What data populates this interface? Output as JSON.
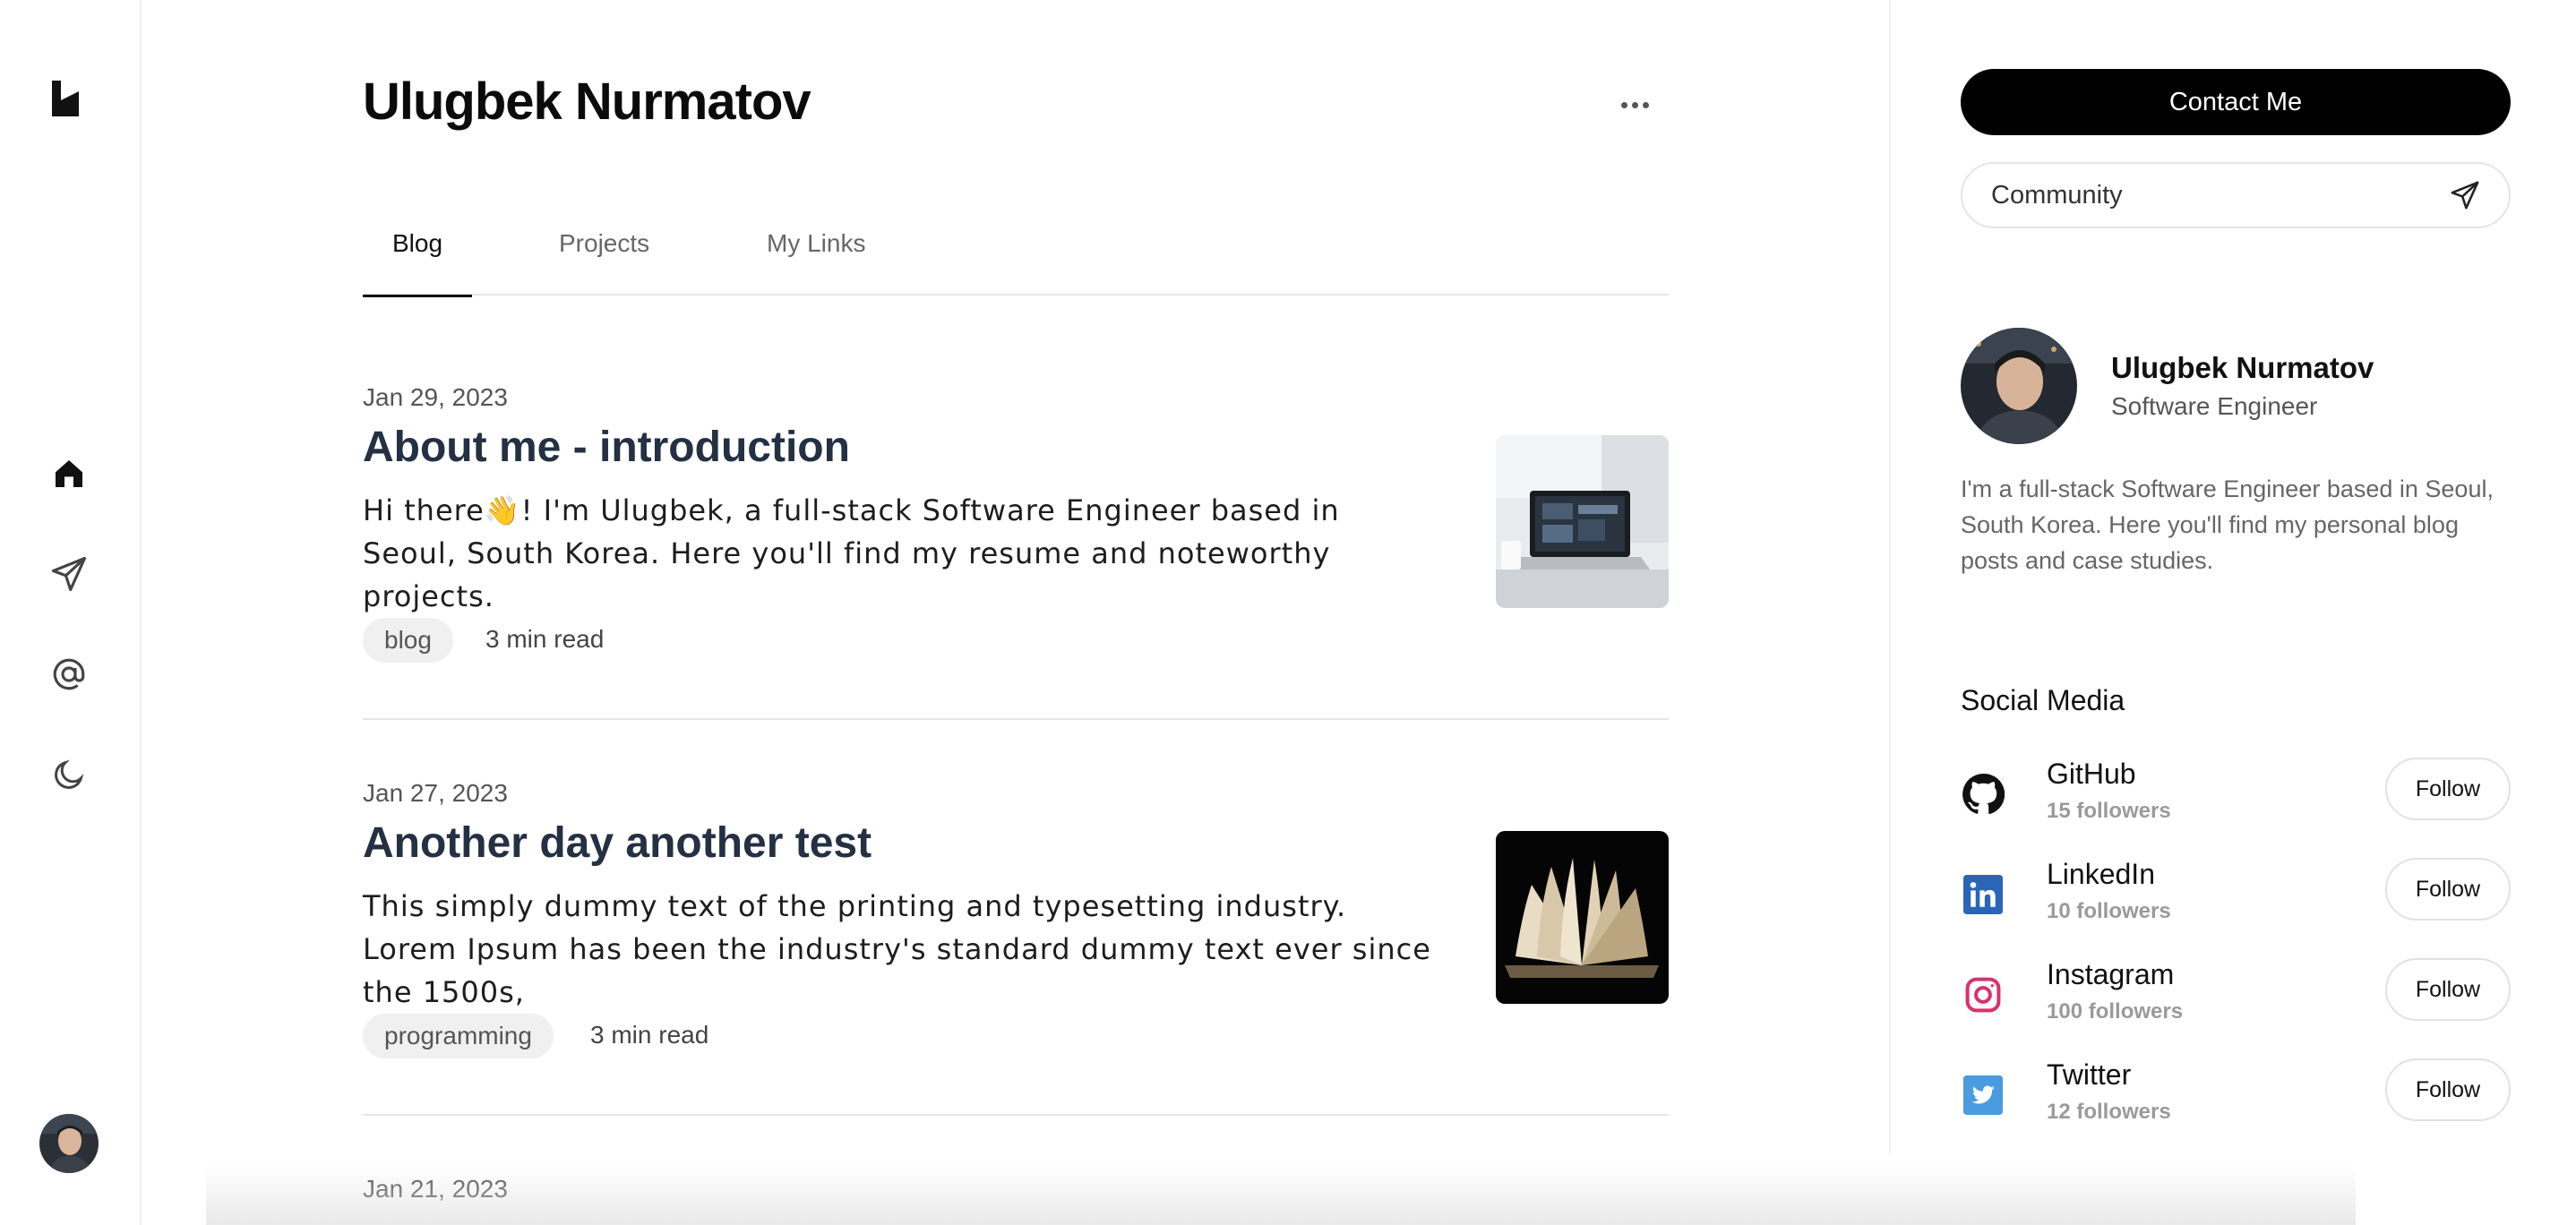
{
  "profile": {
    "name": "Ulugbek Nurmatov",
    "more_label": "More options"
  },
  "tabs": [
    {
      "label": "Blog",
      "active": true
    },
    {
      "label": "Projects",
      "active": false
    },
    {
      "label": "My Links",
      "active": false
    }
  ],
  "posts": [
    {
      "date": "Jan 29, 2023",
      "title": "About me - introduction",
      "excerpt": "Hi there👋! I'm Ulugbek, a full-stack Software Engineer based in Seoul, South Korea. Here you'll find my resume and noteworthy projects.",
      "tag": "blog",
      "read_time": "3 min read",
      "thumb_icon": "laptop-desk-photo"
    },
    {
      "date": "Jan 27, 2023",
      "title": "Another day another test",
      "excerpt": "This simply dummy text of the printing and typesetting industry. Lorem Ipsum has been the industry's standard dummy text ever since the 1500s,",
      "tag": "programming",
      "read_time": "3 min read",
      "thumb_icon": "open-book-photo"
    },
    {
      "date": "Jan 21, 2023"
    }
  ],
  "rail": {
    "icons": [
      "logo-icon",
      "home-icon",
      "send-icon",
      "at-icon",
      "moon-icon",
      "avatar"
    ]
  },
  "sidebar": {
    "contact_label": "Contact Me",
    "community_label": "Community",
    "name": "Ulugbek Nurmatov",
    "role": "Software Engineer",
    "bio": "I'm a full-stack Software Engineer based in Seoul, South Korea. Here you'll find my personal blog posts and case studies.",
    "social_heading": "Social Media",
    "social": [
      {
        "name": "GitHub",
        "followers": "15 followers",
        "follow_label": "Follow",
        "icon": "github-icon",
        "color": "#111111"
      },
      {
        "name": "LinkedIn",
        "followers": "10 followers",
        "follow_label": "Follow",
        "icon": "linkedin-icon",
        "color": "#2a66b8"
      },
      {
        "name": "Instagram",
        "followers": "100 followers",
        "follow_label": "Follow",
        "icon": "instagram-icon",
        "color": "#d6336c"
      },
      {
        "name": "Twitter",
        "followers": "12 followers",
        "follow_label": "Follow",
        "icon": "twitter-icon",
        "color": "#4a9be0"
      }
    ]
  },
  "colors": {
    "accent": "#000000",
    "title_text": "#243043",
    "tag_bg": "#f0f0f0"
  }
}
